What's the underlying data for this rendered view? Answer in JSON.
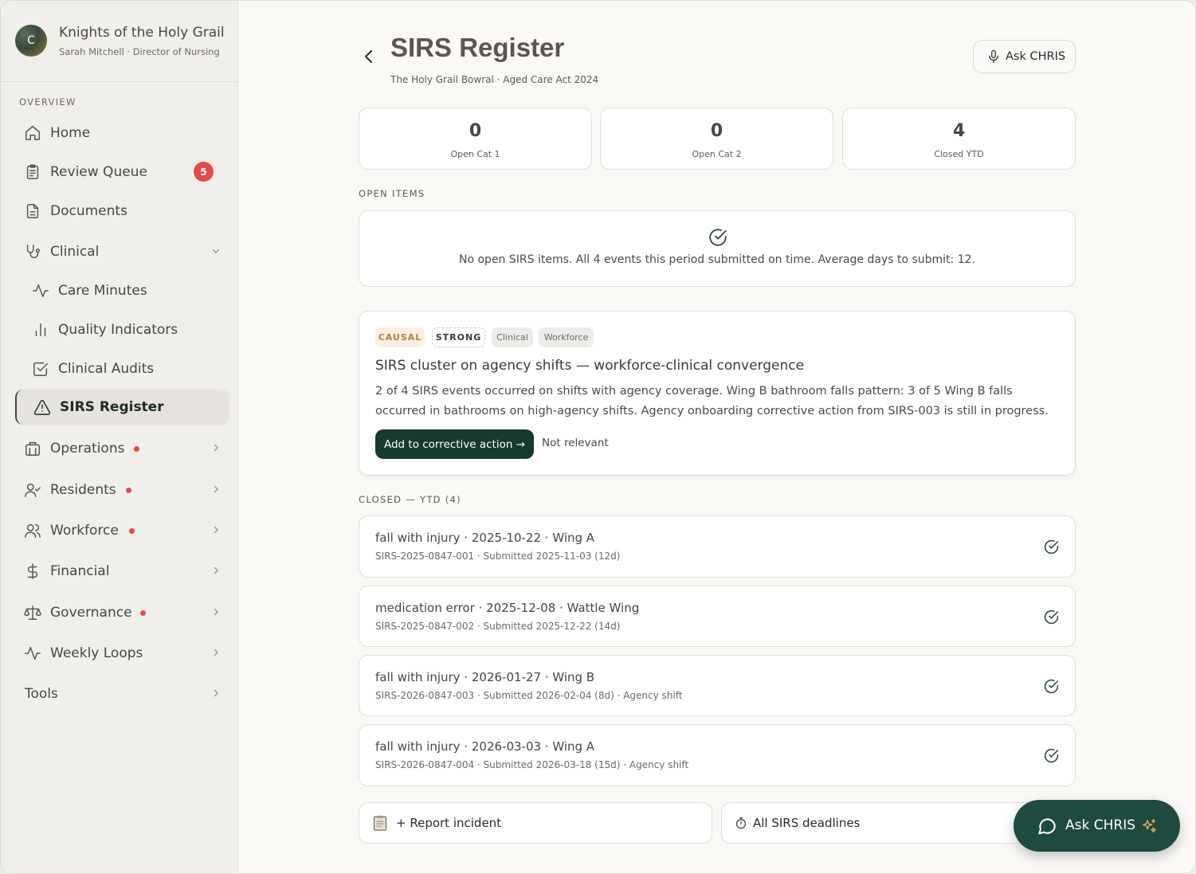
{
  "org": {
    "avatar_letter": "C",
    "name": "Knights of the Holy Grail",
    "user": "Sarah Mitchell · Director of Nursing"
  },
  "sidebar": {
    "section_label": "OVERVIEW",
    "items": [
      {
        "label": "Home",
        "icon": "home-icon"
      },
      {
        "label": "Review Queue",
        "icon": "clipboard-icon",
        "badge": "5"
      },
      {
        "label": "Documents",
        "icon": "document-icon"
      },
      {
        "label": "Clinical",
        "icon": "stethoscope-icon",
        "expanded": true
      },
      {
        "label": "Care Minutes",
        "icon": "activity-icon",
        "sub": true
      },
      {
        "label": "Quality Indicators",
        "icon": "bar-chart-icon",
        "sub": true
      },
      {
        "label": "Clinical Audits",
        "icon": "check-square-icon",
        "sub": true
      },
      {
        "label": "SIRS Register",
        "icon": "warning-icon",
        "sub": true,
        "active": true
      },
      {
        "label": "Operations",
        "icon": "building-icon",
        "alert": true
      },
      {
        "label": "Residents",
        "icon": "user-check-icon",
        "alert": true
      },
      {
        "label": "Workforce",
        "icon": "users-icon",
        "alert": true
      },
      {
        "label": "Financial",
        "icon": "dollar-icon"
      },
      {
        "label": "Governance",
        "icon": "scales-icon",
        "alert": true
      },
      {
        "label": "Weekly Loops",
        "icon": "activity-icon"
      },
      {
        "label": "Tools"
      }
    ]
  },
  "header": {
    "title": "SIRS Register",
    "subtitle": "The Holy Grail Bowral · Aged Care Act 2024",
    "ask_label": "Ask CHRIS"
  },
  "stats": [
    {
      "value": "0",
      "label": "Open Cat 1"
    },
    {
      "value": "0",
      "label": "Open Cat 2"
    },
    {
      "value": "4",
      "label": "Closed YTD"
    }
  ],
  "open_items": {
    "heading": "OPEN ITEMS",
    "empty_text": "No open SIRS items. All 4 events this period submitted on time. Average days to submit: 12."
  },
  "insight": {
    "tags": [
      "CAUSAL",
      "STRONG",
      "Clinical",
      "Workforce"
    ],
    "title": "SIRS cluster on agency shifts — workforce-clinical convergence",
    "body": "2 of 4 SIRS events occurred on shifts with agency coverage. Wing B bathroom falls pattern: 3 of 5 Wing B falls occurred in bathrooms on high-agency shifts. Agency onboarding corrective action from SIRS-003 is still in progress.",
    "primary_action": "Add to corrective action →",
    "secondary_action": "Not relevant"
  },
  "closed": {
    "heading": "CLOSED — YTD (4)",
    "rows": [
      {
        "title": "fall with injury · 2025-10-22 · Wing A",
        "detail": "SIRS-2025-0847-001 · Submitted 2025-11-03 (12d)"
      },
      {
        "title": "medication error · 2025-12-08 · Wattle Wing",
        "detail": "SIRS-2025-0847-002 · Submitted 2025-12-22 (14d)"
      },
      {
        "title": "fall with injury · 2026-01-27 · Wing B",
        "detail": "SIRS-2026-0847-003 · Submitted 2026-02-04 (8d) · Agency shift"
      },
      {
        "title": "fall with injury · 2026-03-03 · Wing A",
        "detail": "SIRS-2026-0847-004 · Submitted 2026-03-18 (15d) · Agency shift"
      }
    ]
  },
  "footer_actions": {
    "report": "+ Report incident",
    "deadlines": "All SIRS deadlines"
  },
  "fab": {
    "label": "Ask CHRIS"
  },
  "colors": {
    "accent": "#163a2e",
    "alert": "#e24b4a",
    "causal": "#b0853b",
    "fab": "#1f4a3f"
  }
}
